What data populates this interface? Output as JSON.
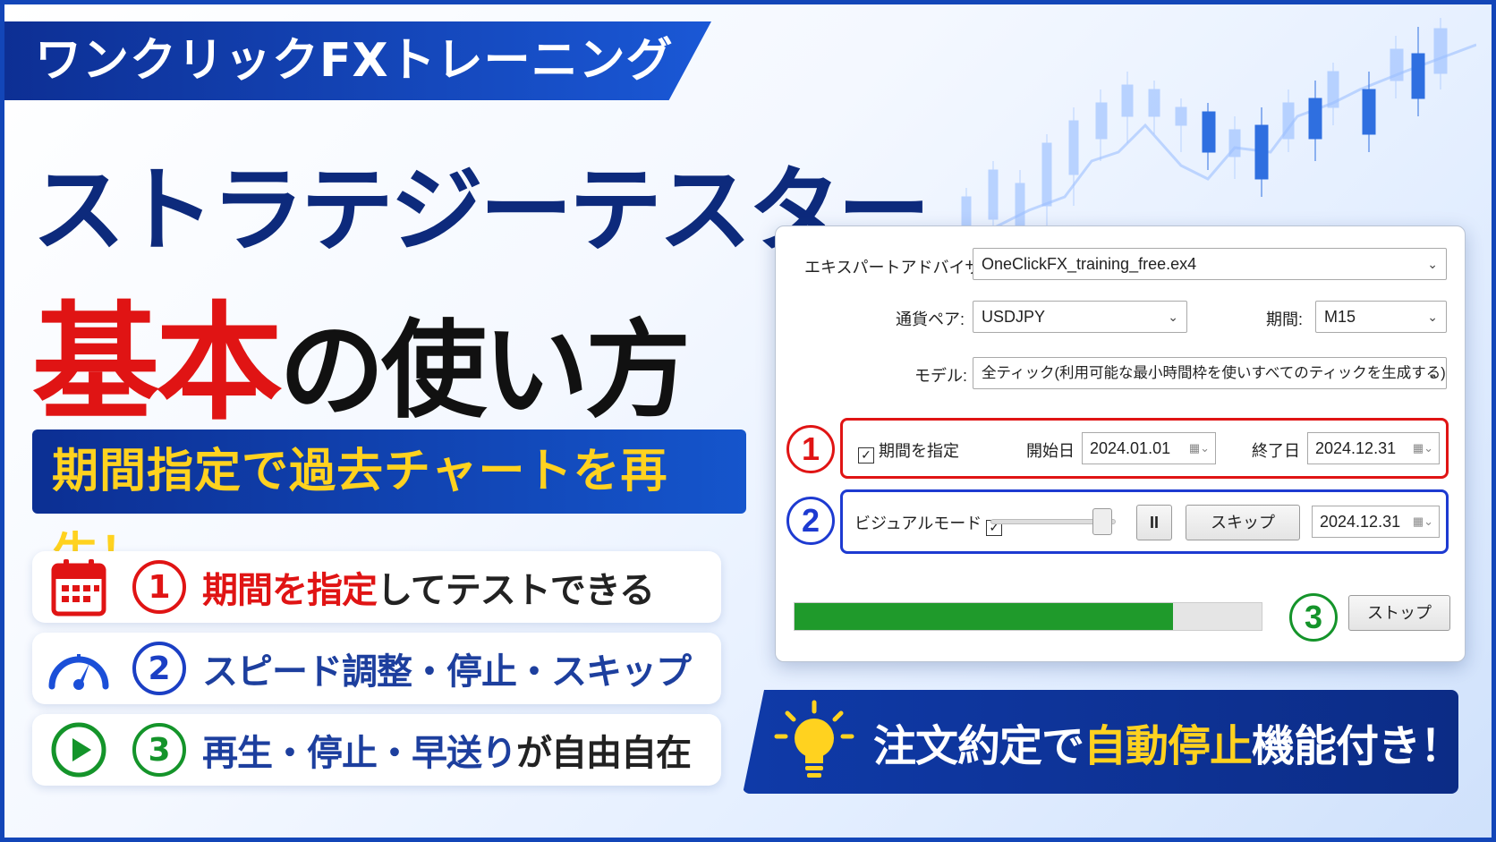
{
  "brand": "ワンクリックFXトレーニング",
  "title_line1": "ストラテジーテスター",
  "title_line2_red": "基本",
  "title_line2_black": "の使い方",
  "subtitle": "期間指定で過去チャートを再生！",
  "features": [
    {
      "num": "1",
      "icon": "calendar-icon",
      "highlight": "期間を指定",
      "rest": "してテストできる",
      "color": "#e01414"
    },
    {
      "num": "2",
      "icon": "speedometer-icon",
      "highlight": "スピード調整・停止・スキップ",
      "rest": "",
      "color": "#1b3fc4"
    },
    {
      "num": "3",
      "icon": "play-icon",
      "highlight": "再生・停止・早送り",
      "rest": "が自由自在",
      "color": "#14942a"
    }
  ],
  "tester": {
    "expert_label": "エキスパートアドバイザ",
    "expert_value": "OneClickFX_training_free.ex4",
    "symbol_label": "通貨ペア:",
    "symbol_value": "USDJPY",
    "period_label": "期間:",
    "period_value": "M15",
    "model_label": "モデル:",
    "model_value": "全ティック(利用可能な最小時間枠を使いすべてのティックを生成する)",
    "use_date_label": "期間を指定",
    "use_date_checked": true,
    "from_label": "開始日",
    "from_value": "2024.01.01",
    "to_label": "終了日",
    "to_value": "2024.12.31",
    "visual_label": "ビジュアルモード",
    "visual_checked": true,
    "pause_label": "II",
    "skip_label": "スキップ",
    "skip_date": "2024.12.31",
    "progress": 0.81,
    "stop_label": "ストップ",
    "badges": [
      "1",
      "2",
      "3"
    ]
  },
  "bottom_banner": {
    "prefix": "注文約定で",
    "highlight": "自動停止",
    "suffix": "機能付き！"
  },
  "colors": {
    "navy": "#0d2a7c",
    "red": "#e01414",
    "blue": "#1b3fc4",
    "green": "#14942a",
    "yellow": "#ffd21f"
  }
}
